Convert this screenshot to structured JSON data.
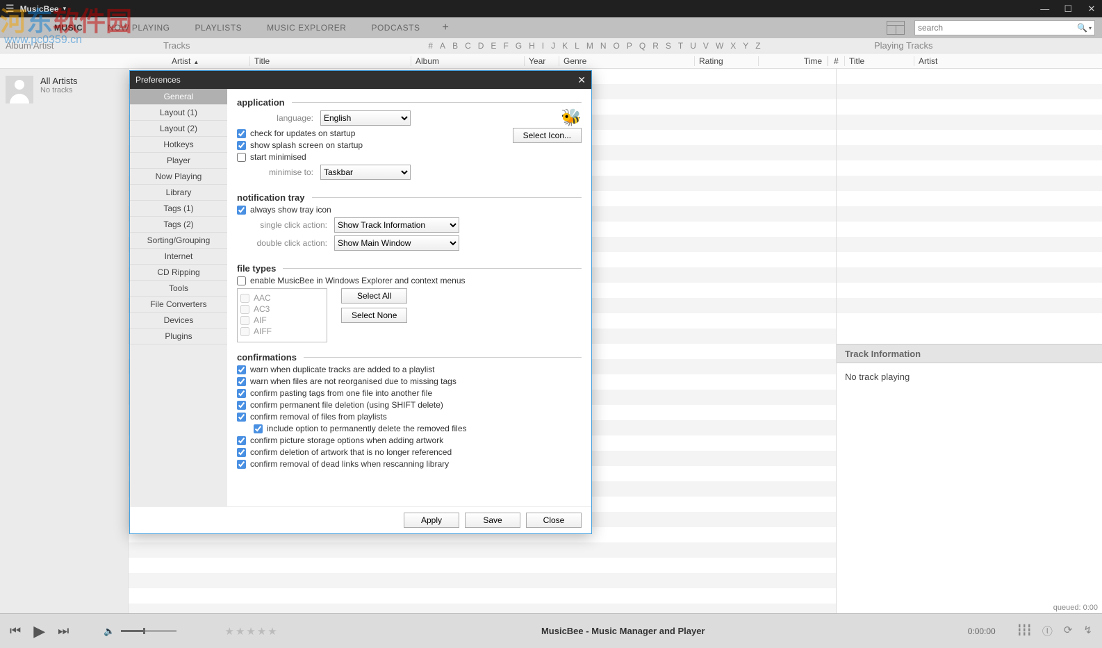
{
  "app": {
    "title": "MusicBee"
  },
  "tabs": [
    "MUSIC",
    "NOW PLAYING",
    "PLAYLISTS",
    "MUSIC EXPLORER",
    "PODCASTS"
  ],
  "search": {
    "placeholder": "search"
  },
  "headerrow": {
    "c1": "Album Artist",
    "c2": "Tracks",
    "c4": "Playing Tracks"
  },
  "alpha": [
    "#",
    "A",
    "B",
    "C",
    "D",
    "E",
    "F",
    "G",
    "H",
    "I",
    "J",
    "K",
    "L",
    "M",
    "N",
    "O",
    "P",
    "Q",
    "R",
    "S",
    "T",
    "U",
    "V",
    "W",
    "X",
    "Y",
    "Z"
  ],
  "cols": {
    "artist": "Artist",
    "title": "Title",
    "album": "Album",
    "year": "Year",
    "genre": "Genre",
    "rating": "Rating",
    "time": "Time",
    "num": "#",
    "pt_title": "Title",
    "pt_artist": "Artist"
  },
  "left": {
    "all": "All Artists",
    "none": "No tracks"
  },
  "right": {
    "ti": "Track Information",
    "notrack": "No track playing"
  },
  "queued": "queued: 0:00",
  "player": {
    "status": "MusicBee - Music Manager and Player",
    "time": "0:00:00"
  },
  "watermark": {
    "text": "河东软件园",
    "url": "www.pc0359.cn"
  },
  "dlg": {
    "title": "Preferences",
    "sidebar": [
      "General",
      "Layout (1)",
      "Layout (2)",
      "Hotkeys",
      "Player",
      "Now Playing",
      "Library",
      "Tags (1)",
      "Tags (2)",
      "Sorting/Grouping",
      "Internet",
      "CD Ripping",
      "Tools",
      "File Converters",
      "Devices",
      "Plugins"
    ],
    "app": {
      "legend": "application",
      "lang_lbl": "language:",
      "lang_val": "English",
      "chk_updates": "check for updates on startup",
      "chk_splash": "show splash screen on startup",
      "chk_startmin": "start minimised",
      "min_lbl": "minimise to:",
      "min_val": "Taskbar",
      "select_icon": "Select Icon..."
    },
    "tray": {
      "legend": "notification tray",
      "chk_always": "always show tray icon",
      "single_lbl": "single click action:",
      "single_val": "Show Track Information",
      "double_lbl": "double click action:",
      "double_val": "Show Main Window"
    },
    "ft": {
      "legend": "file types",
      "chk_enable": "enable MusicBee in Windows Explorer and context menus",
      "types": [
        "AAC",
        "AC3",
        "AIF",
        "AIFF"
      ],
      "sel_all": "Select All",
      "sel_none": "Select None"
    },
    "conf": {
      "legend": "confirmations",
      "items": [
        "warn when duplicate tracks are added to a playlist",
        "warn when files are not reorganised due to missing tags",
        "confirm pasting tags from one file into another file",
        "confirm permanent file deletion (using SHIFT delete)",
        "confirm removal of files from playlists"
      ],
      "indent": "include option to permanently delete the removed files",
      "items2": [
        "confirm picture storage options when adding artwork",
        "confirm deletion of artwork that is no longer referenced",
        "confirm removal of dead links when rescanning library"
      ]
    },
    "btns": {
      "apply": "Apply",
      "save": "Save",
      "close": "Close"
    }
  }
}
